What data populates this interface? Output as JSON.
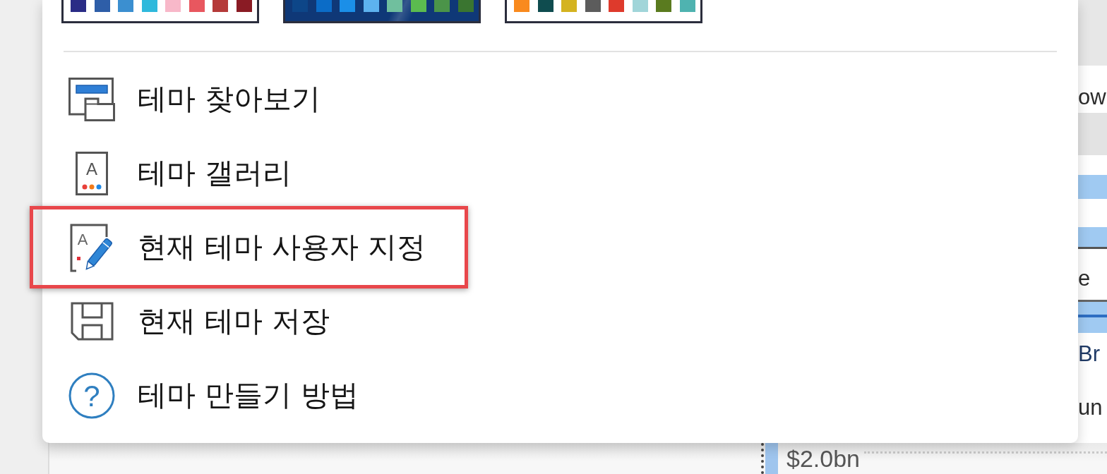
{
  "themes": [
    {
      "color": "#ffffff",
      "swatches": [
        {
          "color": "#2a2c86"
        },
        {
          "color": "#2e5ea8"
        },
        {
          "color": "#3b8fd0"
        },
        {
          "color": "#2fb9dc"
        },
        {
          "color": "#f8b8c9"
        },
        {
          "color": "#e8575f"
        },
        {
          "color": "#b53a39"
        },
        {
          "color": "#8a1b24"
        }
      ]
    },
    {
      "color": "#0f3877",
      "swatches": [
        {
          "color": "#0d4688"
        },
        {
          "color": "#0b6cc7"
        },
        {
          "color": "#1b8fe8"
        },
        {
          "color": "#5db2ef"
        },
        {
          "color": "#70bf9e"
        },
        {
          "color": "#5bbb4f"
        },
        {
          "color": "#4b9449"
        },
        {
          "color": "#3a7530"
        }
      ]
    },
    {
      "color": "#ffffff",
      "swatches": [
        {
          "color": "#f98a1e"
        },
        {
          "color": "#0f4c4f"
        },
        {
          "color": "#d4b320"
        },
        {
          "color": "#5c5c5c"
        },
        {
          "color": "#de3a2c"
        },
        {
          "color": "#a1d5d9"
        },
        {
          "color": "#5a7b1f"
        },
        {
          "color": "#4fb3b0"
        }
      ]
    }
  ],
  "menu": {
    "items": [
      {
        "label": "테마 찾아보기",
        "highlighted": false
      },
      {
        "label": "테마 갤러리",
        "icon_letter": "A",
        "highlighted": false
      },
      {
        "label": "현재 테마 사용자 지정",
        "icon_letter": "A",
        "highlighted": true
      },
      {
        "label": "현재 테마 저장",
        "highlighted": false
      },
      {
        "label": "테마 만들기 방법",
        "icon_letter": "?",
        "highlighted": false
      }
    ]
  },
  "report": {
    "cut_off_texts": [
      "ow",
      "e",
      "Br",
      "un"
    ],
    "axis_label": "$2.0bn"
  }
}
